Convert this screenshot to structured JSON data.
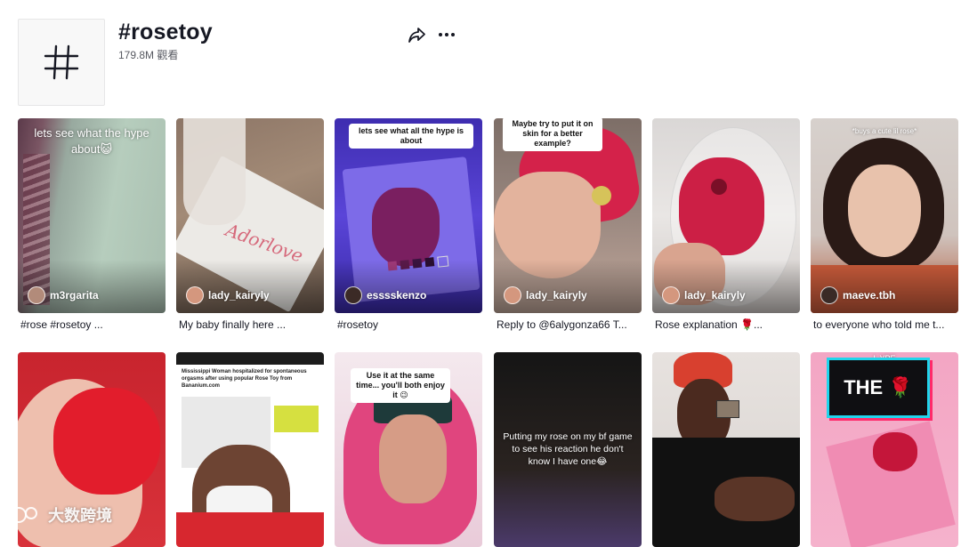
{
  "header": {
    "title": "#rosetoy",
    "views": "179.8M 觀看",
    "icons": {
      "hashtag": "hashtag-icon",
      "share": "share-icon",
      "more": "more-icon"
    }
  },
  "videos": [
    {
      "author": "m3rgarita",
      "caption": "#rose #rosetoy ...",
      "overlay": "lets see what the hype about😺"
    },
    {
      "author": "lady_kairyly",
      "caption": "My baby finally here ...",
      "overlay_script": "Adorlove"
    },
    {
      "author": "esssskenzo",
      "caption": "#rosetoy",
      "bubble": "lets see what all the hype is about"
    },
    {
      "author": "lady_kairyly",
      "caption": "Reply to @6alygonza66 T...",
      "bubble": "Maybe try to put it on skin for a better example?"
    },
    {
      "author": "lady_kairyly",
      "caption": "Rose explanation 🌹..."
    },
    {
      "author": "maeve.tbh",
      "caption": "to everyone who told me t...",
      "overlay": "*buys a cute lil rose*"
    },
    {
      "author": "",
      "caption": ""
    },
    {
      "author": "",
      "caption": "",
      "headline": "Mississippi Woman hospitalized for spontaneous orgasms after using popular Rose Toy from Bananium.com"
    },
    {
      "author": "",
      "caption": "",
      "bubble": "Use it at the same time... you'll both enjoy it 😉"
    },
    {
      "author": "",
      "caption": "",
      "overlay": "Putting my rose on my bf game to see his reaction he don't know I have one😂"
    },
    {
      "author": "",
      "caption": ""
    },
    {
      "author": "",
      "caption": "",
      "badge": "THE 🌹",
      "overlay": "L  YPE"
    }
  ],
  "watermark": "大数跨境"
}
